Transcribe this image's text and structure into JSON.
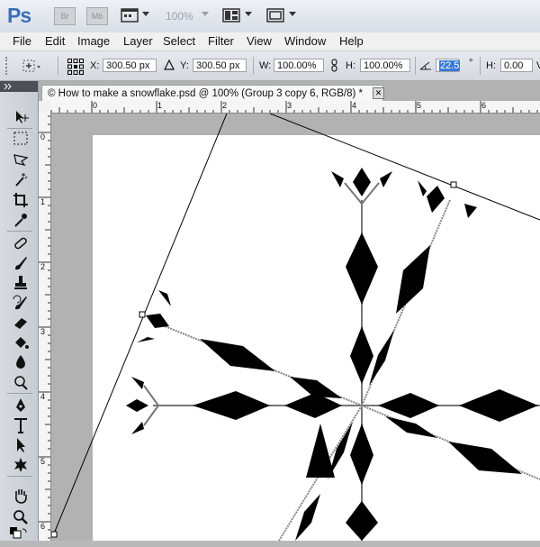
{
  "app_bar": {
    "logo": "Ps",
    "bridge_label": "Br",
    "minibridge_label": "Mb",
    "zoom": "100%"
  },
  "menu": [
    "File",
    "Edit",
    "Image",
    "Layer",
    "Select",
    "Filter",
    "View",
    "Window",
    "Help"
  ],
  "options": {
    "x_label": "X:",
    "x_value": "300.50 px",
    "y_label": "Y:",
    "y_value": "300.50 px",
    "w_label": "W:",
    "w_value": "100.00%",
    "h_label": "H:",
    "h_value": "100.00%",
    "angle_value": "22.5",
    "degree_symbol": "°",
    "hskew_label": "H:",
    "hskew_value": "0.00",
    "vskew_label": "V:"
  },
  "document": {
    "tab_title": "© How to make a snowflake.psd @ 100% (Group 3 copy 6, RGB/8) *",
    "close_glyph": "✕"
  },
  "rulers": {
    "horizontal": [
      "0",
      "1",
      "2",
      "3",
      "4",
      "5",
      "6"
    ],
    "vertical": [
      "0",
      "1",
      "2",
      "3",
      "4",
      "5",
      "6"
    ]
  },
  "colors": {
    "ps_blue": "#3d6fb7",
    "selection": "#3a7ad5",
    "canvas": "#ffffff",
    "pasteboard": "#b2b2b2"
  },
  "tool_icons": [
    "move-tool-icon",
    "marquee-tool-icon",
    "lasso-tool-icon",
    "quick-selection-icon",
    "crop-tool-icon",
    "eyedropper-tool-icon",
    "healing-brush-icon",
    "brush-tool-icon",
    "clone-stamp-icon",
    "history-brush-icon",
    "eraser-tool-icon",
    "paint-bucket-icon",
    "blur-tool-icon",
    "dodge-tool-icon",
    "pen-tool-icon",
    "type-tool-icon",
    "path-selection-icon",
    "shape-tool-icon",
    "hand-tool-icon",
    "zoom-tool-icon"
  ]
}
